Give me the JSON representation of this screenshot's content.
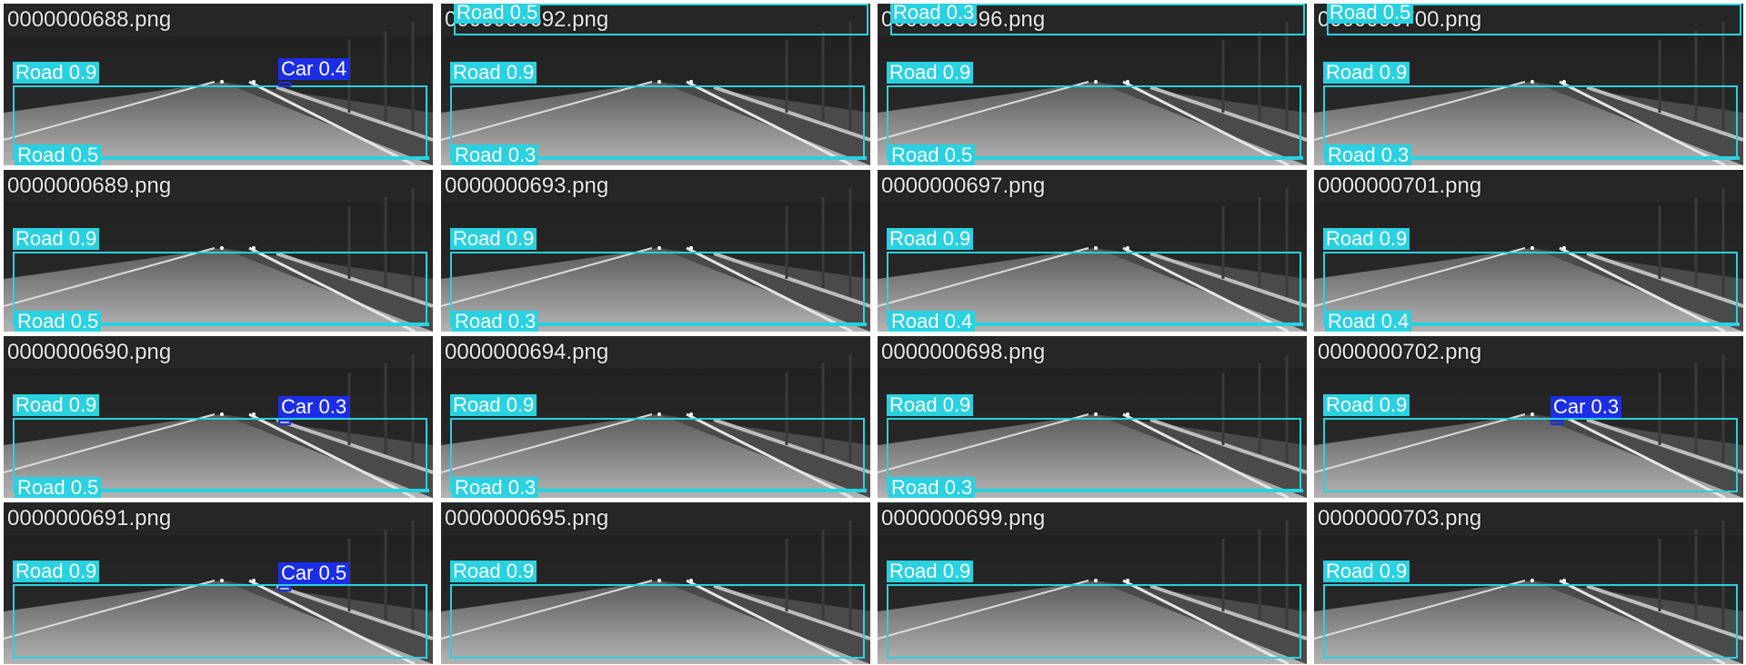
{
  "colors": {
    "road": "#2ad1e0",
    "car": "#1b2ee6",
    "tile_bg": "#3c3c3c"
  },
  "tiles": [
    {
      "file": "0000000688.png",
      "labels": [
        "Road 0.9",
        "Car 0.4",
        "Road 0.5"
      ]
    },
    {
      "file": "0000000692.png",
      "labels": [
        "Road 0.5",
        "Road 0.9",
        "Road 0.3"
      ]
    },
    {
      "file": "0000000696.png",
      "labels": [
        "Road 0.3",
        "Road 0.9",
        "Road 0.5"
      ]
    },
    {
      "file": "0000000700.png",
      "labels": [
        "Road 0.5",
        "Road 0.9",
        "Road 0.3"
      ]
    },
    {
      "file": "0000000689.png",
      "labels": [
        "Road 0.9",
        "Road 0.5"
      ]
    },
    {
      "file": "0000000693.png",
      "labels": [
        "Road 0.9",
        "Road 0.3"
      ]
    },
    {
      "file": "0000000697.png",
      "labels": [
        "Road 0.9",
        "Road 0.4"
      ]
    },
    {
      "file": "0000000701.png",
      "labels": [
        "Road 0.9",
        "Road 0.4"
      ]
    },
    {
      "file": "0000000690.png",
      "labels": [
        "Road 0.9",
        "Car 0.3",
        "Road 0.5"
      ]
    },
    {
      "file": "0000000694.png",
      "labels": [
        "Road 0.9",
        "Road 0.3"
      ]
    },
    {
      "file": "0000000698.png",
      "labels": [
        "Road 0.9",
        "Road 0.3"
      ]
    },
    {
      "file": "0000000702.png",
      "labels": [
        "Road 0.9",
        "Car 0.3"
      ]
    },
    {
      "file": "0000000691.png",
      "labels": [
        "Road 0.9",
        "Car 0.5"
      ]
    },
    {
      "file": "0000000695.png",
      "labels": [
        "Road 0.9"
      ]
    },
    {
      "file": "0000000699.png",
      "labels": [
        "Road 0.9"
      ]
    },
    {
      "file": "0000000703.png",
      "labels": [
        "Road 0.9"
      ]
    }
  ]
}
